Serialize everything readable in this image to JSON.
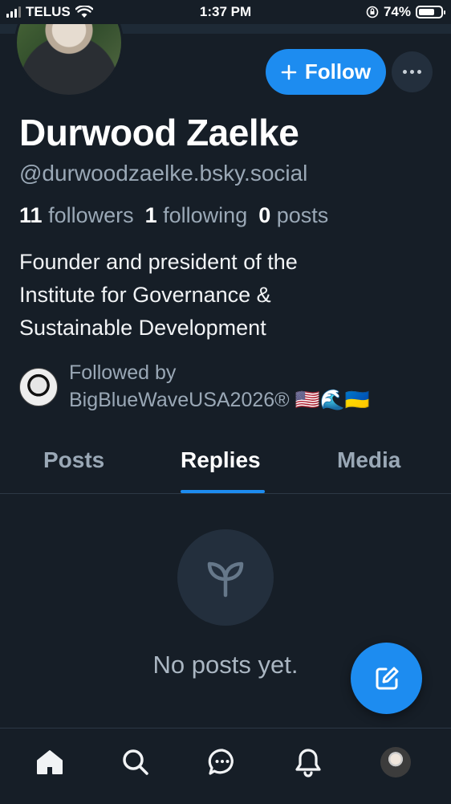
{
  "status_bar": {
    "carrier": "TELUS",
    "time": "1:37 PM",
    "battery": "74%",
    "battery_level": 0.74
  },
  "profile": {
    "follow_label": "Follow",
    "display_name": "Durwood Zaelke",
    "handle": "@durwoodzaelke.bsky.social",
    "stats": {
      "followers_count": "11",
      "followers_label": "followers",
      "following_count": "1",
      "following_label": "following",
      "posts_count": "0",
      "posts_label": "posts"
    },
    "bio_lines": [
      "Founder and president of the",
      "Institute for Governance &",
      "Sustainable Development"
    ],
    "followed_by_label": "Followed by",
    "followed_by_name": "BigBlueWaveUSA2026® 🇺🇸🌊🇺🇦"
  },
  "tabs": [
    {
      "label": "Posts",
      "active": false
    },
    {
      "label": "Replies",
      "active": true
    },
    {
      "label": "Media",
      "active": false
    }
  ],
  "empty_state": {
    "icon": "seedling-icon",
    "text": "No posts yet."
  },
  "bottom_nav": [
    "home-icon",
    "search-icon",
    "chat-icon",
    "bell-icon",
    "profile-avatar"
  ],
  "colors": {
    "background": "#161e27",
    "accent": "#1d8cf0",
    "muted_text": "#9aa8b6"
  }
}
